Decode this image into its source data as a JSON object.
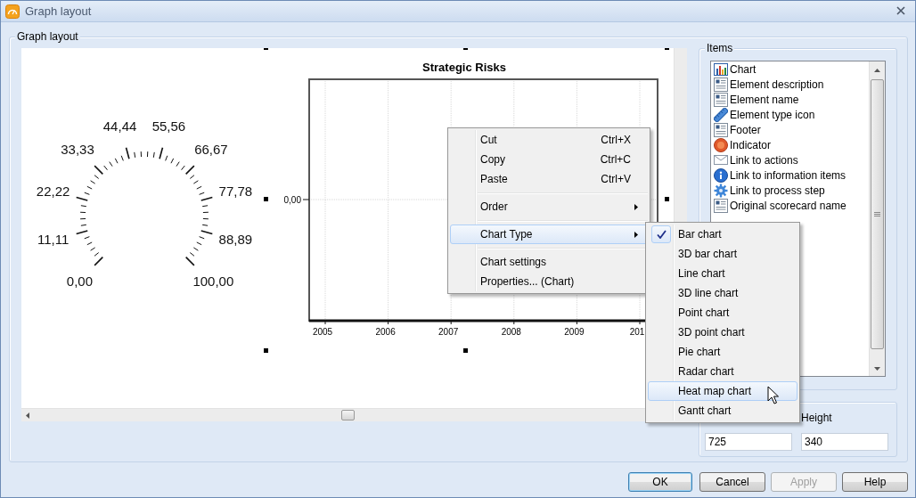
{
  "window": {
    "title": "Graph layout"
  },
  "layout_group": {
    "title": "Graph layout"
  },
  "gauge": {
    "scale_labels": [
      "0,00",
      "11,11",
      "22,22",
      "33,33",
      "44,44",
      "55,56",
      "66,67",
      "77,78",
      "88,89",
      "100,00"
    ]
  },
  "chart": {
    "selected": true,
    "title": "Strategic Risks",
    "x_labels": [
      "2005",
      "2006",
      "2007",
      "2008",
      "2009",
      "201"
    ],
    "y_tick_label": "0,00"
  },
  "items_panel": {
    "title": "Items",
    "items": [
      {
        "label": "Chart",
        "kind": "chart"
      },
      {
        "label": "Element description",
        "kind": "text"
      },
      {
        "label": "Element name",
        "kind": "text"
      },
      {
        "label": "Element type icon",
        "kind": "ruler"
      },
      {
        "label": "Footer",
        "kind": "text"
      },
      {
        "label": "Indicator",
        "kind": "indicator"
      },
      {
        "label": "Link to actions",
        "kind": "mail"
      },
      {
        "label": "Link to information items",
        "kind": "info"
      },
      {
        "label": "Link to process step",
        "kind": "gear"
      },
      {
        "label": "Original scorecard name",
        "kind": "text"
      }
    ]
  },
  "size_fields": {
    "width_value": "725",
    "height_label": "Height",
    "height_value": "340"
  },
  "buttons": [
    {
      "label": "OK",
      "default": true,
      "disabled": false
    },
    {
      "label": "Cancel",
      "default": false,
      "disabled": false
    },
    {
      "label": "Apply",
      "default": false,
      "disabled": true
    },
    {
      "label": "Help",
      "default": false,
      "disabled": false
    }
  ],
  "context_menu": {
    "groups": [
      [
        {
          "label": "Cut",
          "shortcut": "Ctrl+X",
          "has_submenu": false,
          "highlighted": false
        },
        {
          "label": "Copy",
          "shortcut": "Ctrl+C",
          "has_submenu": false,
          "highlighted": false
        },
        {
          "label": "Paste",
          "shortcut": "Ctrl+V",
          "has_submenu": false,
          "highlighted": false
        }
      ],
      [
        {
          "label": "Order",
          "has_submenu": true,
          "highlighted": false
        }
      ],
      [
        {
          "label": "Chart Type",
          "has_submenu": true,
          "highlighted": true
        }
      ],
      [
        {
          "label": "Chart settings",
          "has_submenu": false,
          "highlighted": false
        },
        {
          "label": "Properties... (Chart)",
          "has_submenu": false,
          "highlighted": false
        }
      ]
    ]
  },
  "chart_type_menu": {
    "items": [
      {
        "label": "Bar chart",
        "checked": true,
        "highlighted": false
      },
      {
        "label": "3D bar chart",
        "checked": false,
        "highlighted": false
      },
      {
        "label": "Line chart",
        "checked": false,
        "highlighted": false
      },
      {
        "label": "3D line chart",
        "checked": false,
        "highlighted": false
      },
      {
        "label": "Point chart",
        "checked": false,
        "highlighted": false
      },
      {
        "label": "3D point chart",
        "checked": false,
        "highlighted": false
      },
      {
        "label": "Pie chart",
        "checked": false,
        "highlighted": false
      },
      {
        "label": "Radar chart",
        "checked": false,
        "highlighted": false
      },
      {
        "label": "Heat map chart",
        "checked": false,
        "highlighted": true
      },
      {
        "label": "Gantt chart",
        "checked": false,
        "highlighted": false
      }
    ]
  }
}
